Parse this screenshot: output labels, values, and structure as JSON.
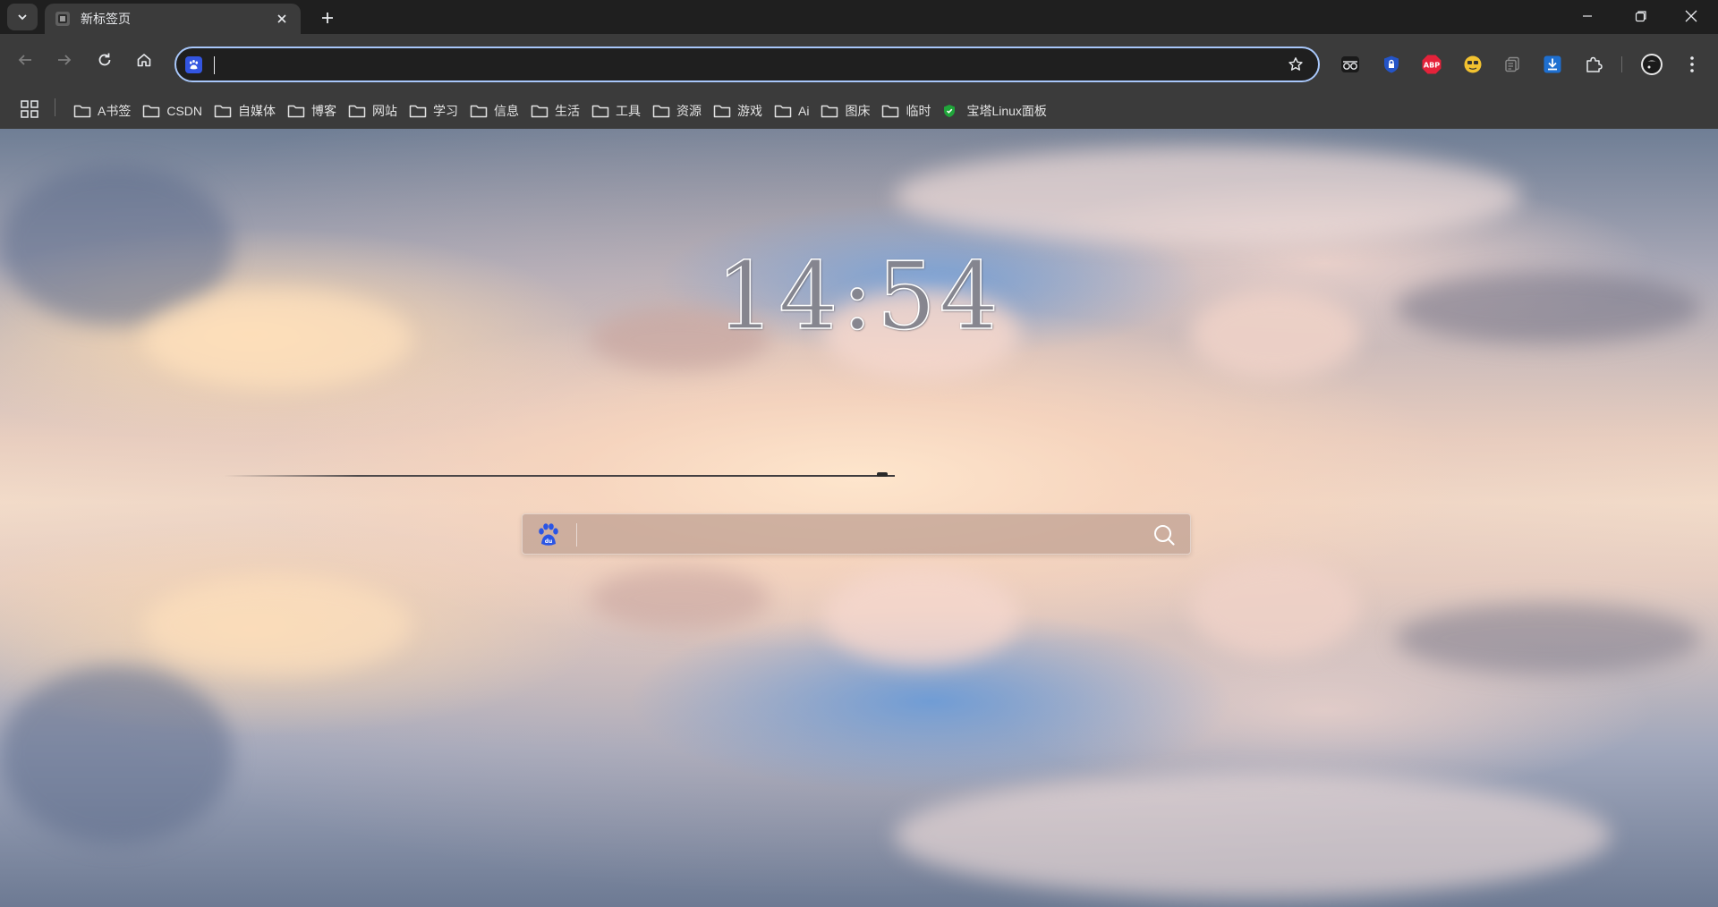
{
  "browser": {
    "tab": {
      "title": "新标签页"
    },
    "omnibox": {
      "value": "",
      "placeholder": ""
    },
    "icons": {
      "tab_search": "chevron-down-icon",
      "tab_close": "close-icon",
      "new_tab": "plus-icon",
      "back": "back-arrow-icon",
      "forward": "forward-arrow-icon",
      "reload": "reload-icon",
      "home": "home-icon",
      "bookmark_star": "star-icon",
      "extensions": "puzzle-icon",
      "menu": "kebab-menu-icon"
    },
    "extensions": [
      "glasses-icon",
      "shield-lock-icon",
      "abp-icon",
      "yellow-face-icon",
      "copy-icon",
      "download-icon"
    ],
    "abp_label": "ABP",
    "window_controls": [
      "minimize-icon",
      "restore-icon",
      "close-icon"
    ]
  },
  "bookmarks": [
    {
      "label": "A书签",
      "icon": "folder-icon"
    },
    {
      "label": "CSDN",
      "icon": "folder-icon"
    },
    {
      "label": "自媒体",
      "icon": "folder-icon"
    },
    {
      "label": "博客",
      "icon": "folder-icon"
    },
    {
      "label": "网站",
      "icon": "folder-icon"
    },
    {
      "label": "学习",
      "icon": "folder-icon"
    },
    {
      "label": "信息",
      "icon": "folder-icon"
    },
    {
      "label": "生活",
      "icon": "folder-icon"
    },
    {
      "label": "工具",
      "icon": "folder-icon"
    },
    {
      "label": "资源",
      "icon": "folder-icon"
    },
    {
      "label": "游戏",
      "icon": "folder-icon"
    },
    {
      "label": "Ai",
      "icon": "folder-icon"
    },
    {
      "label": "图床",
      "icon": "folder-icon"
    },
    {
      "label": "临时",
      "icon": "folder-icon"
    },
    {
      "label": "宝塔Linux面板",
      "icon": "shield-green-icon"
    }
  ],
  "newtab": {
    "clock": "14:54",
    "search": {
      "engine_icon": "baidu-paw-icon",
      "value": "",
      "placeholder": ""
    }
  },
  "colors": {
    "toolbar_bg": "#3b3b3b",
    "tabstrip_bg": "#1f1f1f",
    "omnibox_border": "#a8c7fa",
    "baidu_blue": "#3355e0",
    "abp_red": "#e5223a",
    "bt_green": "#20a53a"
  }
}
